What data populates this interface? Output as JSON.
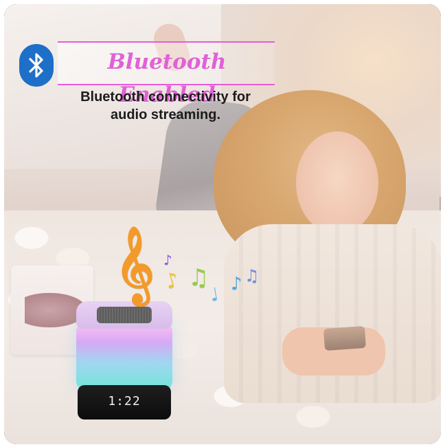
{
  "header": {
    "title": "Bluetooth Enabled",
    "subtitle_line1": "Bluetooth connectivity for",
    "subtitle_line2": "audio streaming."
  },
  "speaker": {
    "clock": "1:22"
  },
  "colors": {
    "title": "#e061d6",
    "accent_line": "#e85ad8",
    "bluetooth_badge": "#1e6fc8"
  },
  "icons": [
    "bluetooth-icon",
    "treble-clef-icon",
    "music-note-icon"
  ]
}
